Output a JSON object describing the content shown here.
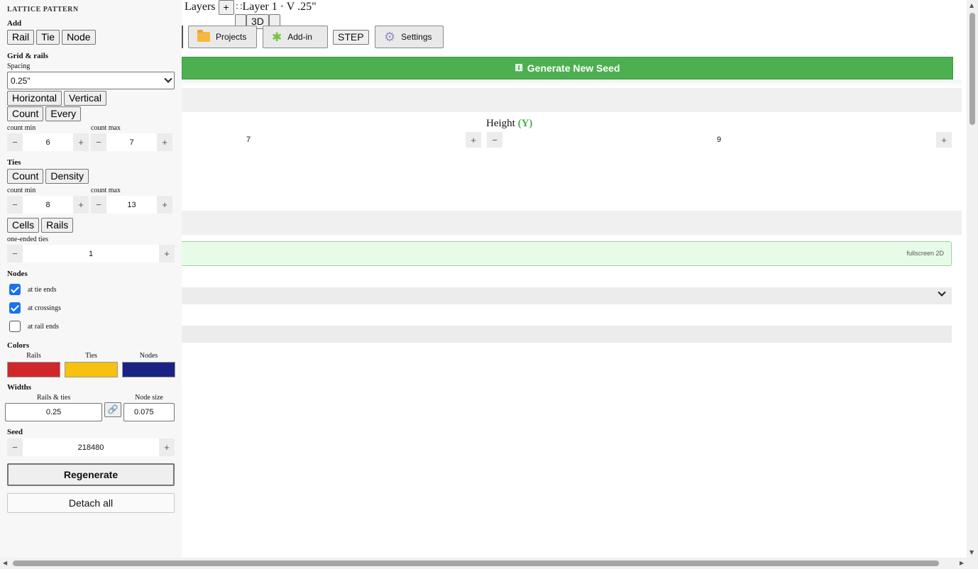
{
  "sidebar": {
    "title": "LATTICE PATTERN",
    "add": {
      "heading": "Add",
      "buttons": [
        "Rail",
        "Tie",
        "Node"
      ]
    },
    "grid": {
      "heading": "Grid & rails",
      "spacing_label": "Spacing",
      "spacing_value": "0.25\"",
      "orientation_buttons": [
        "Horizontal",
        "Vertical"
      ],
      "mode_buttons": [
        "Count",
        "Every"
      ],
      "count_min_label": "count min",
      "count_min_value": "6",
      "count_max_label": "count max",
      "count_max_value": "7"
    },
    "ties": {
      "heading": "Ties",
      "mode_buttons": [
        "Count",
        "Density"
      ],
      "count_min_label": "count min",
      "count_min_value": "8",
      "count_max_label": "count max",
      "count_max_value": "13",
      "scope_buttons": [
        "Cells",
        "Rails"
      ],
      "one_ended_label": "one-ended ties",
      "one_ended_value": "1"
    },
    "nodes": {
      "heading": "Nodes",
      "options": [
        {
          "label": "at tie ends",
          "checked": true
        },
        {
          "label": "at crossings",
          "checked": true
        },
        {
          "label": "at rail ends",
          "checked": false
        }
      ]
    },
    "colors": {
      "heading": "Colors",
      "items": [
        {
          "label": "Rails",
          "color": "#d0272a"
        },
        {
          "label": "Ties",
          "color": "#f6c20f"
        },
        {
          "label": "Nodes",
          "color": "#1a2383"
        }
      ]
    },
    "widths": {
      "heading": "Widths",
      "rails_ties_label": "Rails & ties",
      "rails_ties_value": "0.25",
      "node_size_label": "Node size",
      "node_size_value": "0.075"
    },
    "seed": {
      "heading": "Seed",
      "value": "218480"
    },
    "regenerate_label": "Regenerate",
    "detach_label": "Detach all"
  },
  "main": {
    "layers_label": "Layers",
    "add_layer_label": "+",
    "layer_name": "Layer 1 · V .25\"",
    "view_3d_label": "3D",
    "toolbar": {
      "projects_label": "Projects",
      "addin_label": "Add-in",
      "step_label": "STEP",
      "settings_label": "Settings"
    },
    "generate_label": "Generate New Seed",
    "width_value": "7",
    "height_label": "Height",
    "height_axis": "(Y)",
    "height_value": "9",
    "fullscreen_label": "fullscreen 2D"
  },
  "theme": {
    "accent_green": "#4caf50",
    "checkbox_blue": "#1a73e8"
  }
}
